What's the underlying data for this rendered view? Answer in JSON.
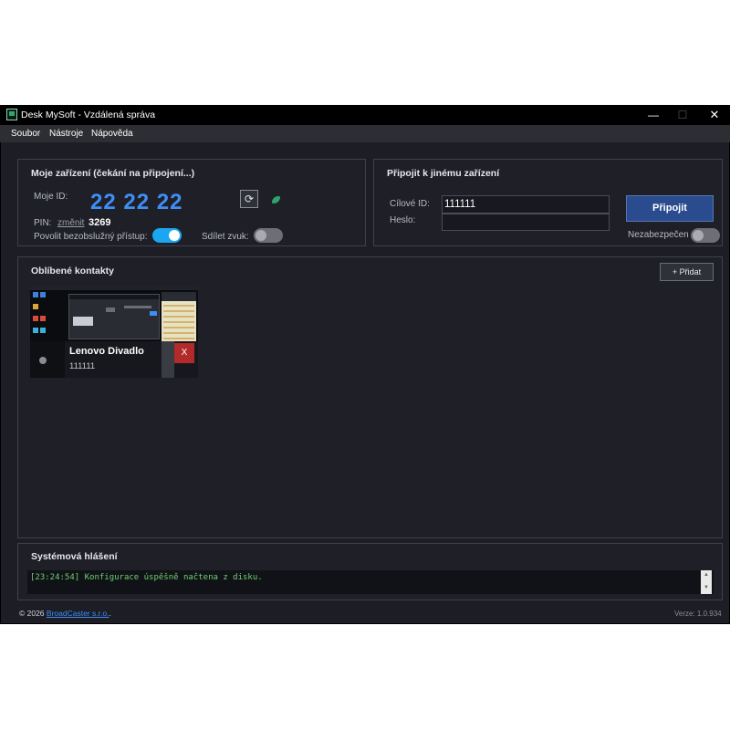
{
  "window": {
    "title": "Desk MySoft - Vzdálená správa",
    "controls": {
      "minimize": "—",
      "maximize": "☐",
      "close": "✕"
    }
  },
  "menu": {
    "items": [
      "Soubor",
      "Nástroje",
      "Nápověda"
    ]
  },
  "my_device": {
    "title": "Moje zařízení (čekání na připojení...)",
    "id_label": "Moje ID:",
    "id_value": "22 22 22",
    "refresh_icon": "refresh-icon",
    "status_color": "#2ea36b",
    "pin_label": "PIN:",
    "pin_change_link": "změnit",
    "pin_value": "3269",
    "unattended_label": "Povolit bezobslužný přístup:",
    "unattended_enabled": true,
    "share_audio_label": "Sdílet zvuk:",
    "share_audio_enabled": false
  },
  "connect": {
    "title": "Připojit k jinému zařízení",
    "target_id_label": "Cílové ID:",
    "target_id_value": "111111",
    "password_label": "Heslo:",
    "password_value": "",
    "connect_button": "Připojit",
    "insecure_label": "Nezabezpečen",
    "insecure_enabled": false
  },
  "favorites": {
    "title": "Oblíbené kontakty",
    "add_button": "+ Přidat",
    "contacts": [
      {
        "name": "Lenovo Divadlo",
        "id": "111111",
        "delete_label": "X"
      }
    ]
  },
  "system_log": {
    "title": "Systémová hlášení",
    "entries": [
      "[23:24:54] Konfigurace úspěšně načtena z disku."
    ]
  },
  "footer": {
    "copyright_prefix": "© 2026",
    "company_link": "BroadCaster s.r.o.",
    "copyright_suffix": ".",
    "version": "Verze: 1.0.934"
  },
  "colors": {
    "accent": "#3f8ef5",
    "toggle_on": "#1aa6f0",
    "connect_button": "#2a4c8e",
    "delete_button": "#b22a2a",
    "log_text": "#6fd16f"
  }
}
